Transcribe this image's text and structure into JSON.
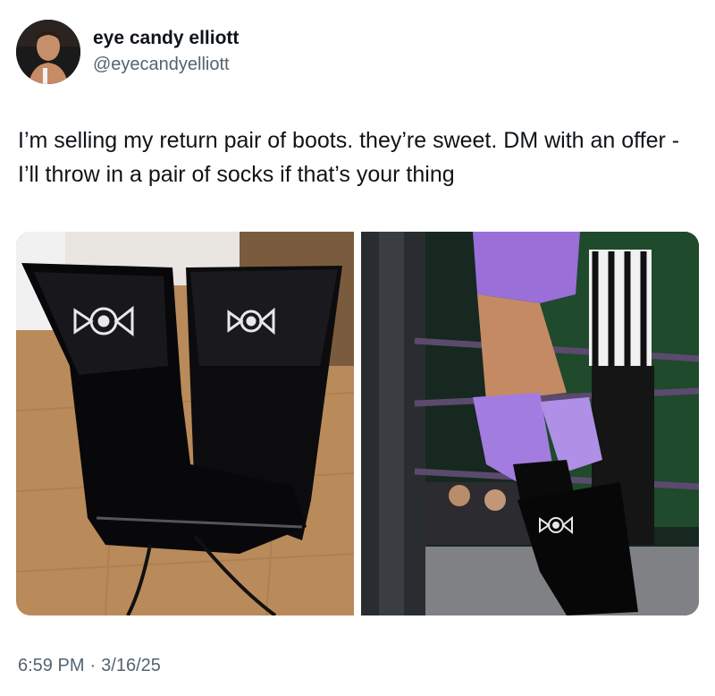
{
  "tweet": {
    "author_name": "eye candy elliott",
    "author_handle": "@eyecandyelliott",
    "text": "I’m selling my return pair of boots. they’re sweet. DM with an offer - I’ll throw in a pair of socks if that’s your thing",
    "time": "6:59 PM",
    "date": "3/16/25"
  },
  "media": [
    {
      "icon": "boots-photo"
    },
    {
      "icon": "wrestler-ring-photo"
    }
  ]
}
